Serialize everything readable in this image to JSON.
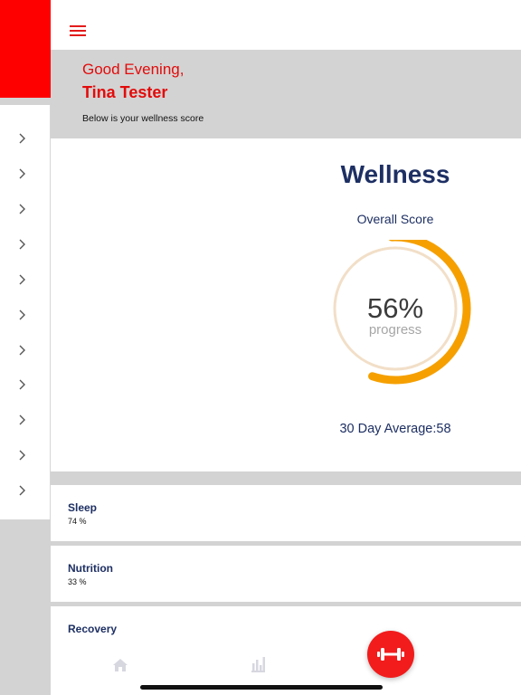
{
  "header": {
    "greeting": "Good Evening,",
    "user_name": "Tina Tester",
    "subtitle": "Below is your wellness score"
  },
  "wellness": {
    "title": "Wellness",
    "score_label": "Overall Score",
    "score_value": "56%",
    "score_fraction": 0.56,
    "progress_label": "progress",
    "average_text": "30 Day Average:58"
  },
  "metrics": [
    {
      "name": "Sleep",
      "value": "74 %"
    },
    {
      "name": "Nutrition",
      "value": "33 %"
    },
    {
      "name": "Recovery",
      "value": ""
    }
  ],
  "colors": {
    "accent_red": "#ff0000",
    "navy": "#1d2f63",
    "gauge_orange": "#f5a000",
    "gauge_track": "#f2dfc8"
  },
  "icons": {
    "menu": "hamburger-menu-icon",
    "sidebar": "chevron-right-icon",
    "home": "home-icon",
    "stats": "bar-chart-icon",
    "workout": "dumbbell-icon"
  }
}
